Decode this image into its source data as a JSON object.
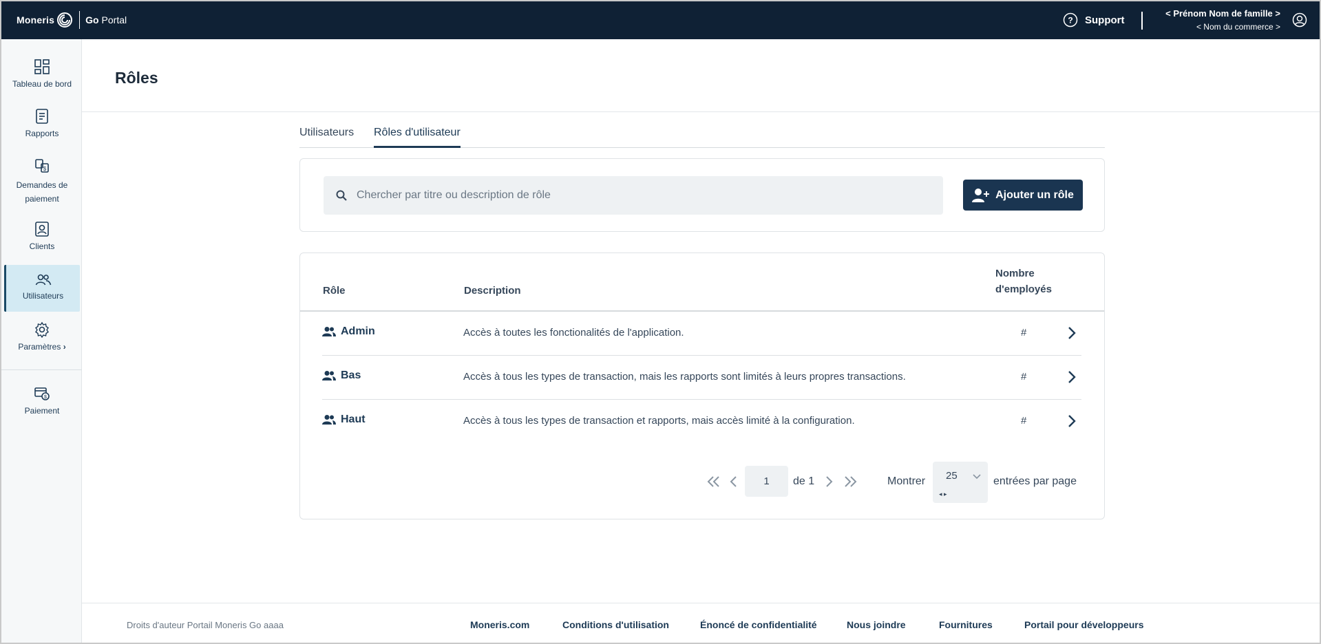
{
  "header": {
    "brand": "Moneris",
    "product_go": "Go",
    "product_portal": "Portal",
    "support_label": "Support",
    "user_name": "< Prénom Nom de famille >",
    "business_name": "< Nom du commerce >"
  },
  "sidebar": {
    "items": [
      {
        "label": "Tableau de bord",
        "icon": "dashboard-icon"
      },
      {
        "label": "Rapports",
        "icon": "reports-icon"
      },
      {
        "label": "Demandes de paiement",
        "icon": "payment-request-icon"
      },
      {
        "label": "Clients",
        "icon": "clients-icon"
      },
      {
        "label": "Utilisateurs",
        "icon": "users-icon",
        "active": true
      },
      {
        "label": "Paramètres",
        "icon": "settings-icon"
      },
      {
        "label": "Paiement",
        "icon": "payment-icon"
      }
    ]
  },
  "page": {
    "title": "Rôles",
    "tabs": [
      {
        "label": "Utilisateurs"
      },
      {
        "label": "Rôles d'utilisateur",
        "active": true
      }
    ]
  },
  "search": {
    "placeholder": "Chercher par titre ou description de rôle",
    "value": ""
  },
  "add_button_label": "Ajouter un rôle",
  "table": {
    "headers": {
      "role": "Rôle",
      "description": "Description",
      "count_line1": "Nombre",
      "count_line2": "d'employés"
    },
    "rows": [
      {
        "role": "Admin",
        "description": "Accès à toutes les fonctionalités de l'application.",
        "count": "#"
      },
      {
        "role": "Bas",
        "description": "Accès à tous les types de transaction, mais les rapports sont limités à leurs propres transactions.",
        "count": "#"
      },
      {
        "role": "Haut",
        "description": "Accès à tous les types de transaction et rapports, mais accès limité à la configuration.",
        "count": "#"
      }
    ]
  },
  "pagination": {
    "current_page": "1",
    "of_total": "de 1",
    "show_label": "Montrer",
    "page_size": "25",
    "per_page_label": "entrées par page"
  },
  "footer": {
    "copyright": "Droits d'auteur Portail Moneris Go  aaaa",
    "links": [
      {
        "label": "Moneris.com"
      },
      {
        "label": "Conditions d'utilisation"
      },
      {
        "label": "Énoncé de confidentialité"
      },
      {
        "label": "Nous joindre"
      },
      {
        "label": "Fournitures"
      },
      {
        "label": "Portail pour développeurs"
      }
    ]
  },
  "colors": {
    "topbar": "#0f2135",
    "primary": "#1a3551",
    "active_nav": "#d3eaf3"
  }
}
